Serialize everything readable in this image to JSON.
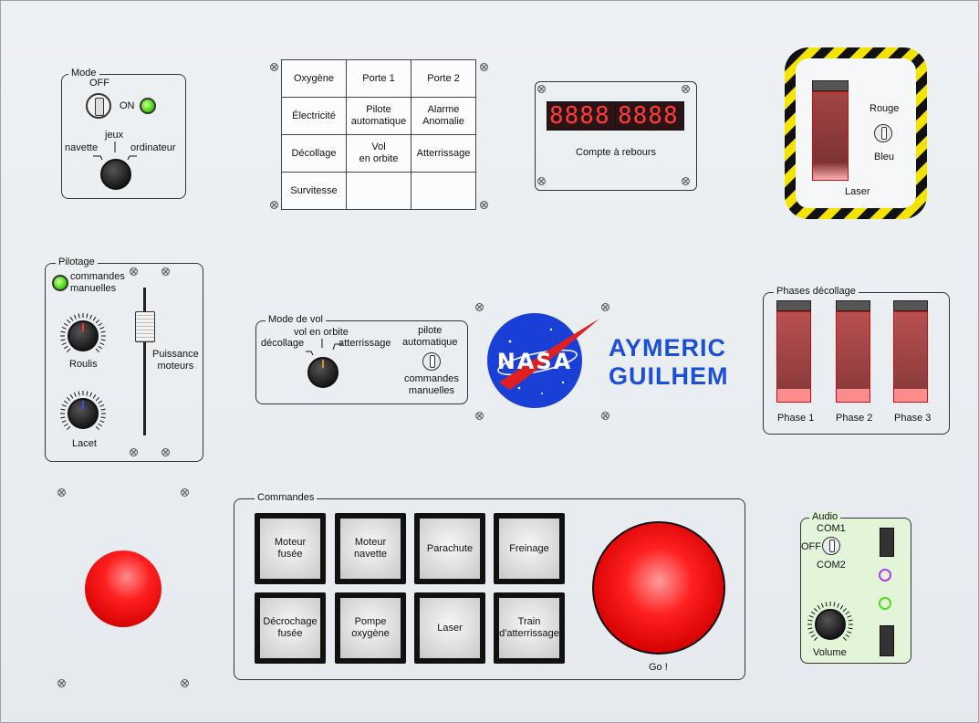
{
  "mode_panel": {
    "title": "Mode",
    "key_off": "OFF",
    "key_on": "ON",
    "selector_center": "jeux",
    "selector_left": "navette",
    "selector_right": "ordinateur"
  },
  "function_grid": {
    "rows": [
      [
        "Oxygène",
        "Porte 1",
        "Porte 2"
      ],
      [
        "Électricité",
        "Pilote\nautomatique",
        "Alarme\nAnomalie"
      ],
      [
        "Décollage",
        "Vol\nen orbite",
        "Atterrissage"
      ],
      [
        "Survitesse",
        "",
        ""
      ]
    ]
  },
  "countdown": {
    "display_left": "8888",
    "display_right": "8888",
    "label": "Compte à rebours"
  },
  "laser_panel": {
    "toggle_top": "Rouge",
    "toggle_bottom": "Bleu",
    "label": "Laser"
  },
  "pilotage": {
    "title": "Pilotage",
    "led_label": "commandes\nmanuelles",
    "knob1_label": "Roulis",
    "knob2_label": "Lacet",
    "slider_label": "Puissance\nmoteurs"
  },
  "flight_mode": {
    "title": "Mode de vol",
    "pos_left": "décollage",
    "pos_center": "vol en orbite",
    "pos_right": "atterrissage",
    "toggle_top": "pilote\nautomatique",
    "toggle_bottom": "commandes\nmanuelles"
  },
  "logo": {
    "nasa_text": "NASA",
    "name_line1": "AYMERIC",
    "name_line2": "GUILHEM"
  },
  "phases": {
    "title": "Phases décollage",
    "labels": [
      "Phase 1",
      "Phase 2",
      "Phase 3"
    ]
  },
  "commands": {
    "title": "Commandes",
    "buttons": [
      "Moteur\nfusée",
      "Moteur\nnavette",
      "Parachute",
      "Freinage",
      "Décrochage\nfusée",
      "Pompe\noxygène",
      "Laser",
      "Train\nd'atterrissage"
    ],
    "go_label": "Go !"
  },
  "audio": {
    "title": "Audio",
    "com1": "COM1",
    "off": "OFF",
    "com2": "COM2",
    "volume": "Volume"
  },
  "colors": {
    "led_green": "#4fdc1c",
    "button_red": "#e11",
    "nasa_blue": "#1a3fd6",
    "name_blue": "#1b4fd8",
    "audio_bg": "#e3f5d9",
    "hazard_yellow": "#f3e400"
  }
}
